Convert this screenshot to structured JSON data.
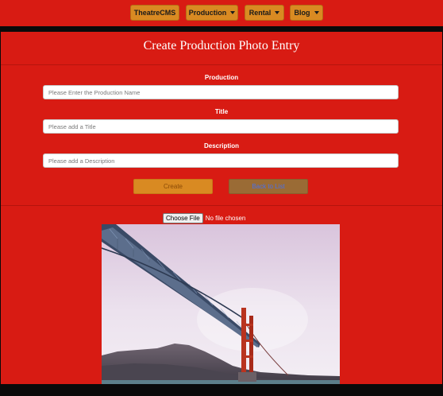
{
  "nav": {
    "home_label": "TheatreCMS",
    "items": [
      {
        "label": "Production"
      },
      {
        "label": "Rental"
      },
      {
        "label": "Blog"
      }
    ]
  },
  "form": {
    "title": "Create Production Photo Entry",
    "fields": [
      {
        "label": "Production",
        "placeholder": "Please Enter the Production Name"
      },
      {
        "label": "Title",
        "placeholder": "Please add a Title"
      },
      {
        "label": "Description",
        "placeholder": "Please add a Description"
      }
    ],
    "create_label": "Create",
    "back_label": "Back to List",
    "file": {
      "button_label": "Choose File",
      "status": "No file chosen"
    }
  },
  "colors": {
    "page_red": "#d81b13",
    "button_orange": "#d98a22",
    "background": "#0a0a0a"
  },
  "icons": [
    "chevron-down-icon"
  ]
}
